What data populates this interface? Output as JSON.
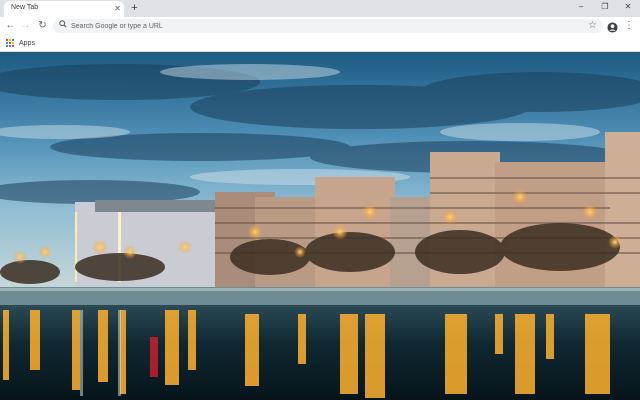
{
  "browser": {
    "tab": {
      "title": "New Tab",
      "close_icon": "close-icon"
    },
    "new_tab_glyph": "+",
    "window_controls": {
      "minimize": "–",
      "restore": "❐",
      "close": "✕"
    },
    "nav": {
      "back": "←",
      "forward": "→",
      "reload": "↻"
    },
    "omnibox": {
      "placeholder": "Search Google or type a URL",
      "value": ""
    },
    "bookmark_star": "☆",
    "menu": "⋮"
  },
  "bookmarks_bar": {
    "apps_label": "Apps",
    "apps_colors": [
      "#ea4335",
      "#fbbc05",
      "#34a853",
      "#4285f4",
      "#ea4335",
      "#fbbc05",
      "#34a853",
      "#4285f4",
      "#ea4335"
    ]
  },
  "colors": {
    "sky_top": "#1e5f86",
    "sky_mid": "#6aa7c8",
    "horizon": "#b9cfd6",
    "building_warm": "#caa991",
    "lights": "#ffb12e",
    "water": "#0f2b34"
  }
}
